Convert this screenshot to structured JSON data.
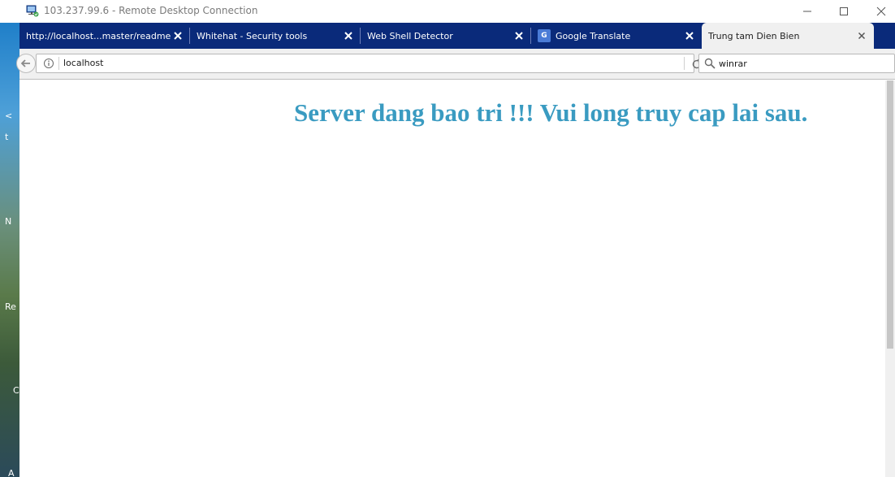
{
  "window": {
    "title": "103.237.99.6 - Remote Desktop Connection",
    "icon": "remote-desktop-icon"
  },
  "tabs": [
    {
      "label": "http://localhost...master/readme.md",
      "active": false
    },
    {
      "label": "Whitehat - Security tools",
      "active": false
    },
    {
      "label": "Web Shell Detector",
      "active": false
    },
    {
      "label": "Google Translate",
      "active": false,
      "icon": "google-translate-icon"
    },
    {
      "label": "Trung tam Dien Bien",
      "active": true
    }
  ],
  "navbar": {
    "url": "localhost",
    "search_value": "winrar"
  },
  "page": {
    "message": "Server dang bao tri !!! Vui long truy cap lai sau.",
    "message_color": "#3a9bc1"
  },
  "desktop": {
    "glyphs": [
      "<",
      "t",
      "N",
      "Re",
      "C",
      "A"
    ]
  },
  "colors": {
    "tab_strip": "#0a2a7a",
    "active_tab": "#f0f0f0"
  }
}
